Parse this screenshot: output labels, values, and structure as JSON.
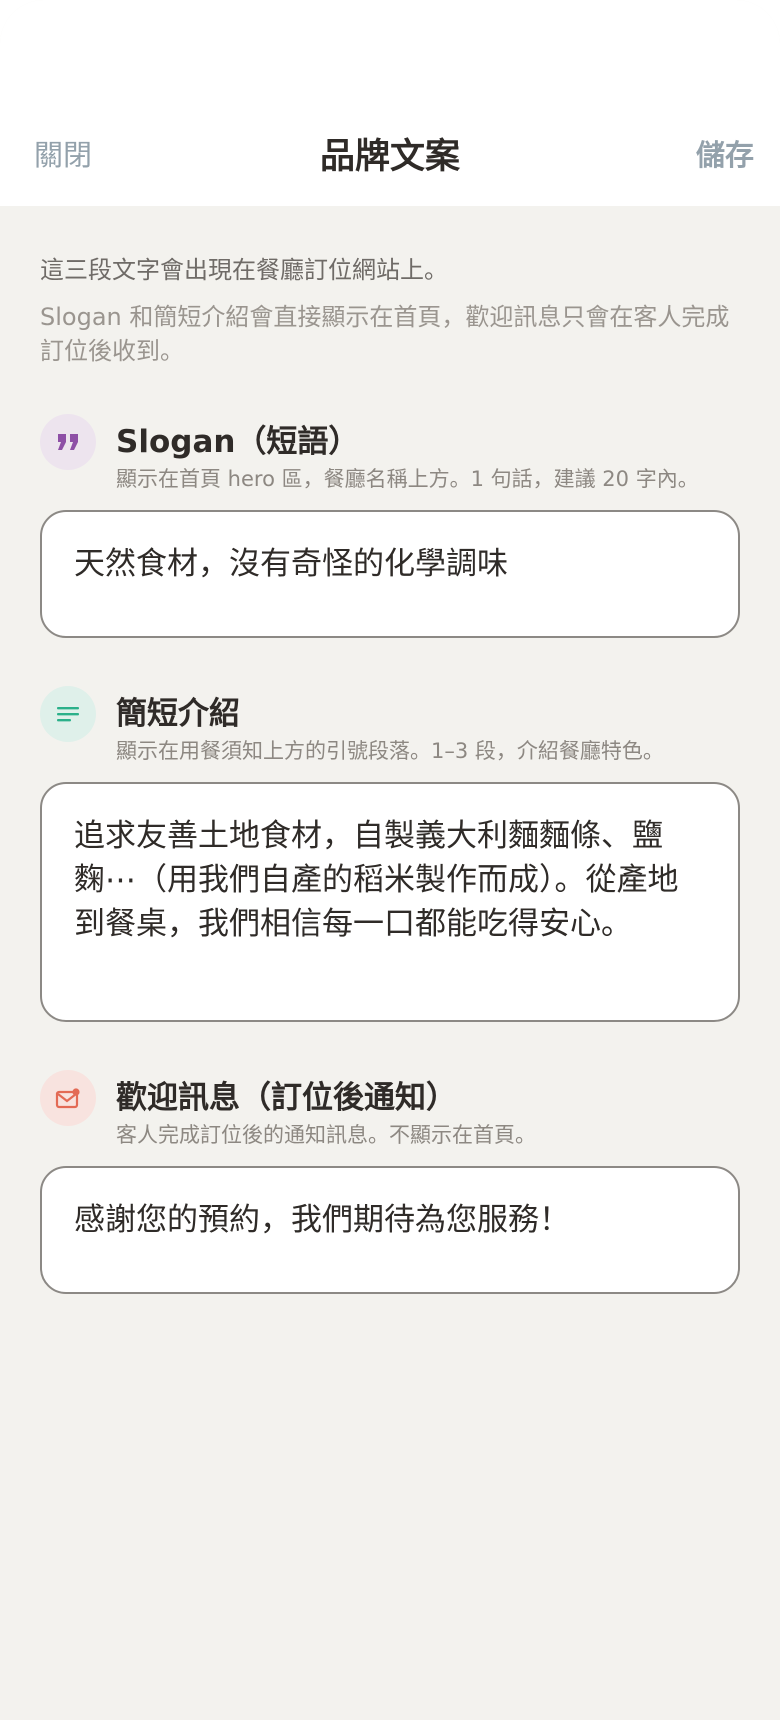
{
  "header": {
    "close_label": "關閉",
    "title": "品牌文案",
    "save_label": "儲存"
  },
  "intro": {
    "line1": "這三段文字會出現在餐廳訂位網站上。",
    "line2": "Slogan 和簡短介紹會直接顯示在首頁，歡迎訊息只會在客人完成訂位後收到。"
  },
  "sections": {
    "slogan": {
      "icon": "quote-icon",
      "title": "Slogan（短語）",
      "description": "顯示在首頁 hero 區，餐廳名稱上方。1 句話，建議 20 字內。",
      "value": "天然食材，沒有奇怪的化學調味"
    },
    "intro": {
      "icon": "text-lines-icon",
      "title": "簡短介紹",
      "description": "顯示在用餐須知上方的引號段落。1–3 段，介紹餐廳特色。",
      "value": "追求友善土地食材，自製義大利麵麵條、鹽麴⋯（用我們自產的稻米製作而成）。從產地到餐桌，我們相信每一口都能吃得安心。"
    },
    "welcome": {
      "icon": "mail-notification-icon",
      "title": "歡迎訊息（訂位後通知）",
      "description": "客人完成訂位後的通知訊息。不顯示在首頁。",
      "value": "感謝您的預約，我們期待為您服務！"
    }
  },
  "colors": {
    "background": "#f3f2ee",
    "quote_icon_bg": "#ede4ee",
    "quote_icon": "#8e4fa6",
    "lines_icon_bg": "#dff0ea",
    "lines_icon": "#2bb08a",
    "mail_icon_bg": "#f8e3df",
    "mail_icon": "#e36a55"
  }
}
